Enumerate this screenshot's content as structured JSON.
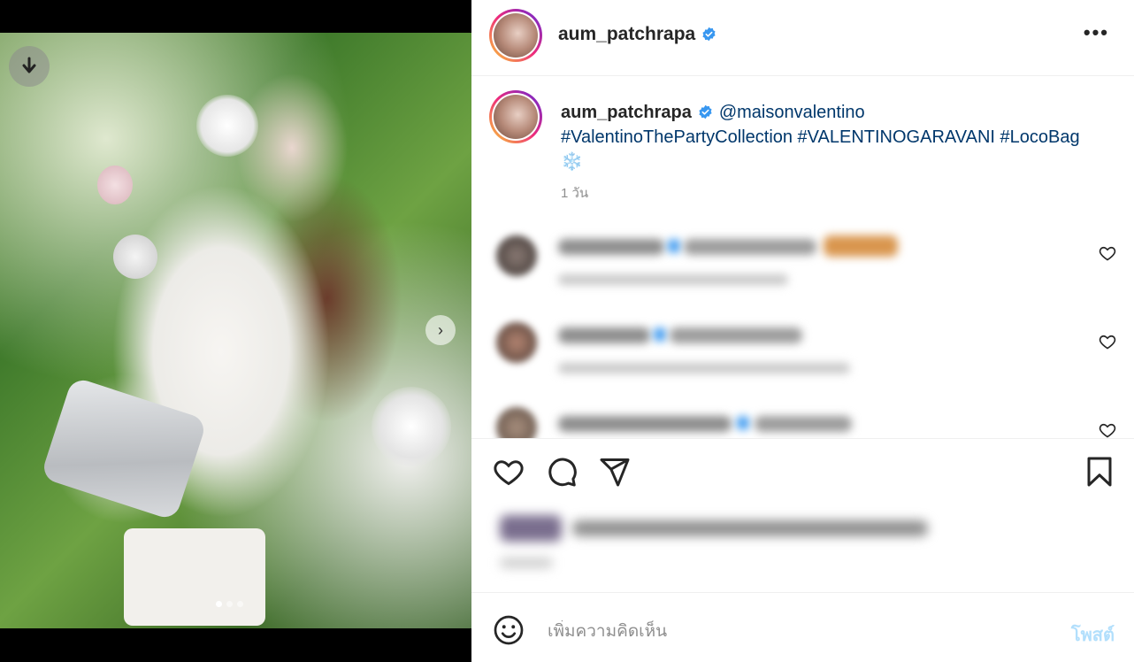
{
  "post": {
    "username": "aum_patchrapa",
    "caption_mention": "@maisonvalentino",
    "caption_tags": "#ValentinoThePartyCollection #VALENTINOGARAVANI #LocoBag",
    "caption_emoji": "❄️",
    "time": "1 วัน"
  },
  "media": {
    "slide_count": 3,
    "active_slide": 1,
    "next_glyph": "›",
    "download_icon": "arrow-down-icon"
  },
  "header": {
    "more_glyph": "•••"
  },
  "composer": {
    "placeholder": "เพิ่มความคิดเห็น",
    "post_label": "โพสต์"
  },
  "colors": {
    "verified": "#3897f0",
    "link": "#00376b",
    "post_disabled": "#b2dffc",
    "ring_start": "#f9ce34",
    "ring_end": "#6228d7"
  },
  "icons": [
    "verified-badge-icon",
    "more-icon",
    "heart-icon",
    "comment-icon",
    "share-icon",
    "bookmark-icon",
    "emoji-icon",
    "next-arrow-icon",
    "download-icon"
  ]
}
